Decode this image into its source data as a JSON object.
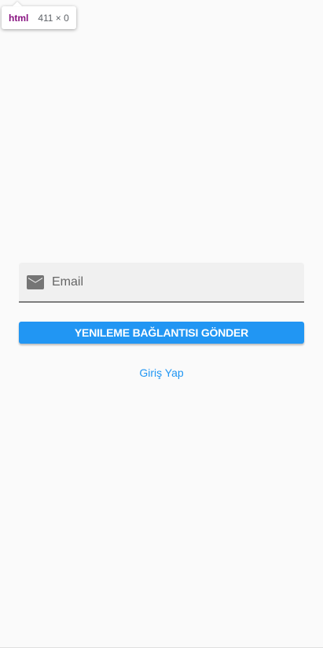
{
  "devtools_tooltip": {
    "tag": "html",
    "dimensions": "411 × 0"
  },
  "form": {
    "email": {
      "icon": "email-icon",
      "placeholder": "Email",
      "value": ""
    },
    "submit_label": "YENILEME BAĞLANTISI GÖNDER",
    "login_link_label": "Giriş Yap"
  },
  "colors": {
    "primary": "#2196f3",
    "background": "#fafafa",
    "field_fill": "#f0f0f0",
    "icon": "#757575"
  }
}
